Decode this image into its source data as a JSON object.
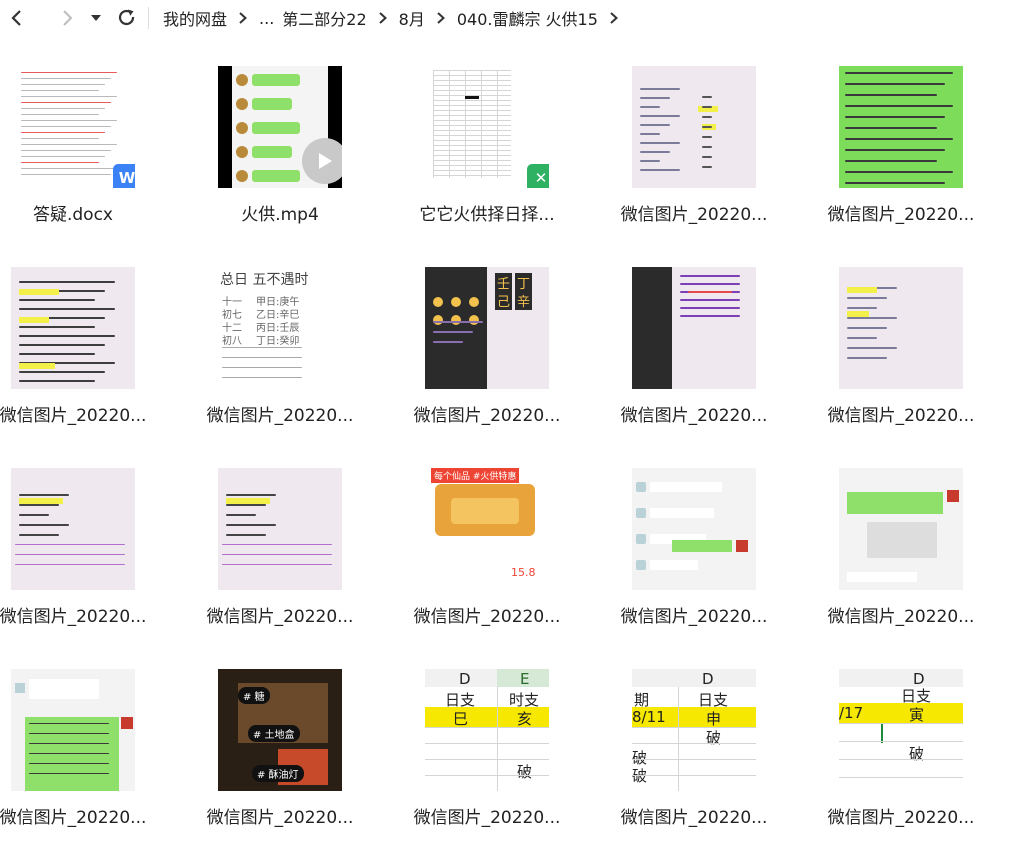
{
  "nav": {
    "back_icon": "back-icon",
    "forward_icon": "forward-icon",
    "dropdown_icon": "dropdown-icon",
    "refresh_icon": "refresh-icon"
  },
  "breadcrumb": {
    "root": "我的网盘",
    "ellipsis": "...",
    "part": "第二部分22",
    "month": "8月",
    "folder": "040.雷麟宗 火供15"
  },
  "files": [
    {
      "name": "答疑.docx",
      "type": "docx"
    },
    {
      "name": "火供.mp4",
      "type": "video"
    },
    {
      "name": "它它火供择日择...",
      "type": "xlsx"
    },
    {
      "name": "微信图片_20220...",
      "type": "image"
    },
    {
      "name": "微信图片_20220...",
      "type": "image"
    },
    {
      "name": "微信图片_20220...",
      "type": "image"
    },
    {
      "name": "微信图片_20220...",
      "type": "image"
    },
    {
      "name": "微信图片_20220...",
      "type": "image"
    },
    {
      "name": "微信图片_20220...",
      "type": "image"
    },
    {
      "name": "微信图片_20220...",
      "type": "image"
    },
    {
      "name": "微信图片_20220...",
      "type": "image"
    },
    {
      "name": "微信图片_20220...",
      "type": "image"
    },
    {
      "name": "微信图片_20220...",
      "type": "image"
    },
    {
      "name": "微信图片_20220...",
      "type": "image"
    },
    {
      "name": "微信图片_20220...",
      "type": "image"
    },
    {
      "name": "微信图片_20220...",
      "type": "image"
    },
    {
      "name": "微信图片_20220...",
      "type": "image"
    },
    {
      "name": "微信图片_20220...",
      "type": "image"
    },
    {
      "name": "微信图片_20220...",
      "type": "image"
    },
    {
      "name": "微信图片_20220...",
      "type": "image"
    }
  ],
  "thumbs": {
    "docx_badge": "W",
    "xlsx_badge": "✕",
    "t2_header": [
      "总日",
      "五不遇时"
    ],
    "t2_rows": [
      "十一",
      "初七",
      "十二",
      "初八"
    ],
    "t2_col": [
      "甲日:庚午",
      "乙日:辛巳",
      "丙日:壬辰",
      "丁日:癸卯"
    ],
    "t8_chars": [
      "壬",
      "丁",
      "己",
      "辛"
    ],
    "t16_header": [
      "D",
      "E"
    ],
    "t16_cells": [
      "日支",
      "时支",
      "巳",
      "亥",
      "破"
    ],
    "t17_header": [
      "D"
    ],
    "t17_cells": [
      "期",
      "日支",
      "8/11",
      "申",
      "破",
      "破",
      "破"
    ],
    "t18_header": [
      "D"
    ],
    "t18_cells": [
      "日支",
      "/17",
      "寅",
      "破"
    ],
    "t15_labels": [
      "# 土地盒",
      "# 酥油灯",
      "# 糖"
    ],
    "t11_title": "每个仙品 #火供特惠",
    "t11_price": "15.8"
  }
}
